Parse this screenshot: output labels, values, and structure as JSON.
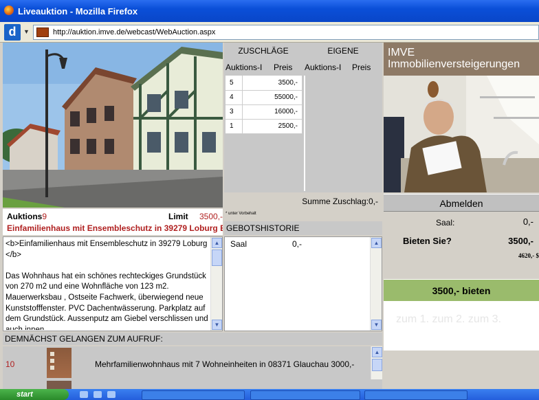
{
  "window": {
    "title": "Liveauktion - Mozilla Firefox"
  },
  "browser": {
    "url": "http://auktion.imve.de/webcast/WebAuction.aspx"
  },
  "lot": {
    "label": "Auktions",
    "number": "9",
    "limit_label": "Limit",
    "limit_value": "3500,-",
    "title": "Einfamilienhaus mit Ensembleschutz in 39279 Loburg E",
    "description": "<b>Einfamilienhaus mit Ensembleschutz in 39279 Loburg </b>\n\nDas Wohnhaus hat ein schönes rechteckiges Grundstück von 270 m2 und eine Wohnfläche von 123 m2. Mauerwerksbau , Ostseite Fachwerk, überwiegend neue  Kunststofffenster. PVC Dachentwässerung. Parkplatz auf dem Grundstück. Aussenputz am Giebel verschlissen und auch innen"
  },
  "tables": {
    "zuschlaege_label": "ZUSCHLÄGE",
    "eigene_label": "EIGENE",
    "col_auktion": "Auktions-I",
    "col_preis": "Preis",
    "zuschlaege": [
      {
        "id": "5",
        "price": "3500,-"
      },
      {
        "id": "4",
        "price": "55000,-"
      },
      {
        "id": "3",
        "price": "16000,-"
      },
      {
        "id": "1",
        "price": "2500,-"
      }
    ],
    "summe": "Summe Zuschlag:0,-",
    "vorbehalt_note": "* unter Vorbehalt"
  },
  "history": {
    "label": "GEBOTSHISTORIE",
    "entries": [
      {
        "who": "Saal",
        "amount": "0,-"
      }
    ]
  },
  "brand": {
    "line1": "IMVE",
    "line2": "Immobilienversteigerungen"
  },
  "bid": {
    "logout": "Abmelden",
    "saal_label": "Saal:",
    "saal_value": "0,-",
    "ask_label": "Bieten Sie?",
    "ask_value": "3500,-",
    "next_value": "4620,- $",
    "bid_button": "3500,-  bieten",
    "tabs_text": "zum 1. zum 2. zum 3."
  },
  "upcoming": {
    "label": "DEMNÄCHST GELANGEN ZUM AUFRUF:",
    "items": [
      {
        "number": "10",
        "title": "Mehrfamilienwohnhaus mit 7 Wohneinheiten in 08371 Glauchau 3000,-"
      }
    ]
  },
  "taskbar": {
    "start": "start"
  }
}
